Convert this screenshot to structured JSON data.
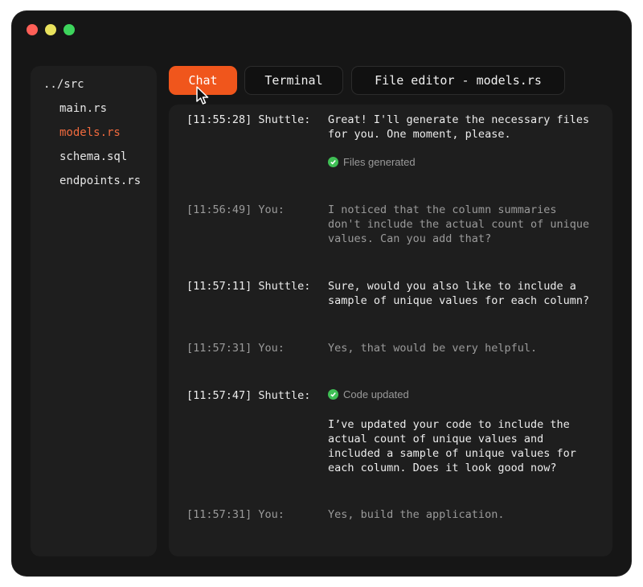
{
  "sidebar": {
    "root": "../src",
    "files": [
      {
        "name": "main.rs",
        "active": false
      },
      {
        "name": "models.rs",
        "active": true
      },
      {
        "name": "schema.sql",
        "active": false
      },
      {
        "name": "endpoints.rs",
        "active": false
      }
    ]
  },
  "tabs": {
    "chat": "Chat",
    "terminal": "Terminal",
    "editor": "File editor - models.rs"
  },
  "messages": [
    {
      "time": "[11:55:28] Shuttle:",
      "text": "Great! I'll generate the necessary files\nfor you. One moment, please.",
      "status": "Files generated"
    },
    {
      "time": "[11:56:49] You:",
      "text": "I noticed that the column summaries\ndon't include the actual count of unique\nvalues. Can you add that?"
    },
    {
      "time": "[11:57:11] Shuttle:",
      "text": "Sure, would you also like to include a\nsample of unique values for each column?"
    },
    {
      "time": "[11:57:31] You:",
      "text": "Yes, that would be very helpful."
    },
    {
      "time": "[11:57:47] Shuttle:",
      "status": "Code updated",
      "text": "I’ve updated your code to include the\nactual count of unique values and\nincluded a sample of unique values for\neach column. Does it look good now?"
    },
    {
      "time": "[11:57:31] You:",
      "text": "Yes, build the application."
    }
  ],
  "colors": {
    "accent": "#f0561c",
    "active_file": "#f06a3e",
    "success": "#3fbf55"
  }
}
